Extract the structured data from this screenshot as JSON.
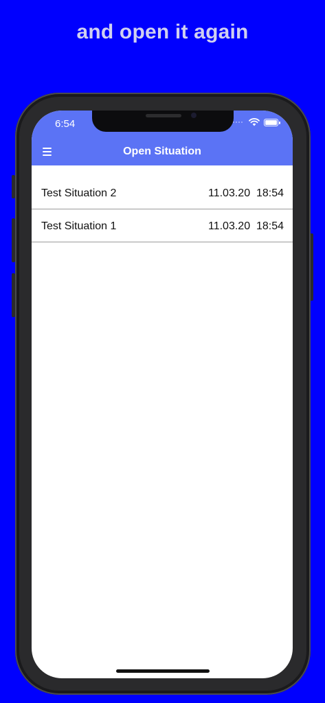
{
  "caption": "and open it again",
  "status_bar": {
    "time": "6:54",
    "icons": [
      "cellular-signal-icon",
      "wifi-icon",
      "battery-icon"
    ]
  },
  "nav": {
    "title": "Open Situation",
    "menu_icon": "hamburger-menu-icon"
  },
  "situations": [
    {
      "name": "Test Situation 2",
      "date": "11.03.20",
      "time": "18:54"
    },
    {
      "name": "Test Situation 1",
      "date": "11.03.20",
      "time": "18:54"
    }
  ],
  "colors": {
    "background": "#0000fe",
    "accent": "#5b73f5",
    "caption": "#d0d0f0",
    "divider": "#9a9a9a"
  }
}
